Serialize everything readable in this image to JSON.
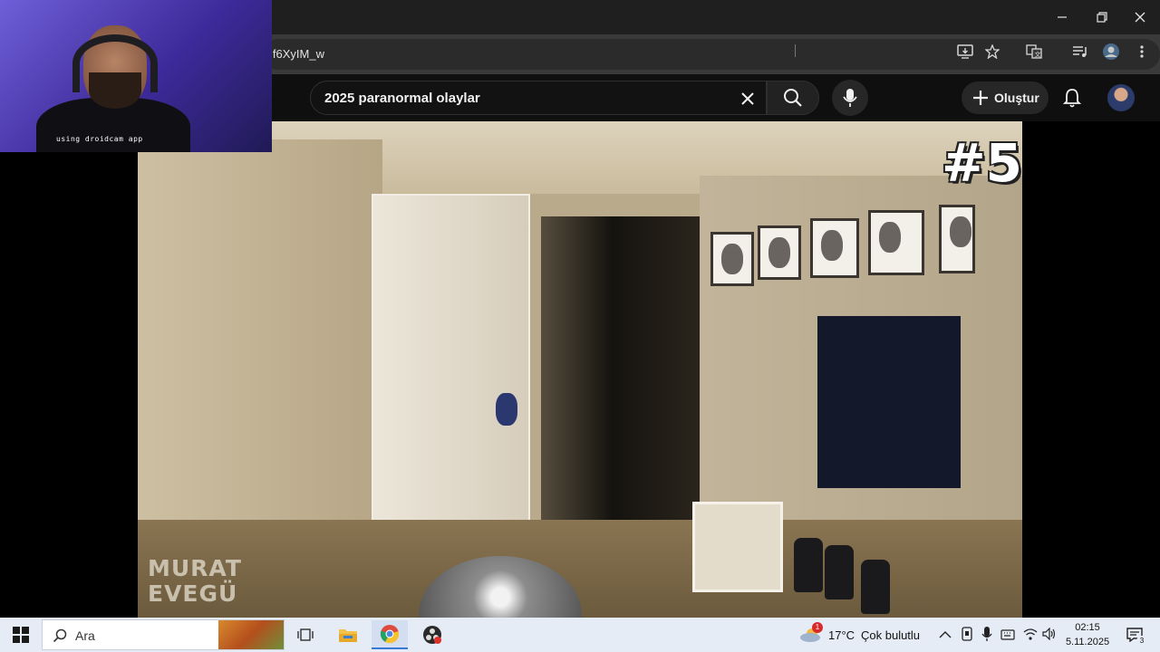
{
  "browser": {
    "url_fragment": "if6XyIM_w",
    "window_controls": [
      "minimize",
      "restore",
      "close"
    ]
  },
  "youtube": {
    "search_query": "2025 paranormal olaylar",
    "create_label": "Oluştur"
  },
  "video": {
    "watermark_line1": "MURAT",
    "watermark_line2": "EVEGÜ",
    "badge": "#5"
  },
  "webcam": {
    "overlay_text": "using droidcam app"
  },
  "taskbar": {
    "search_placeholder": "Ara",
    "weather_temp": "17°C",
    "weather_desc": "Çok bulutlu",
    "weather_alert_count": "1",
    "time": "02:15",
    "date": "5.11.2025",
    "notification_count": "3"
  }
}
